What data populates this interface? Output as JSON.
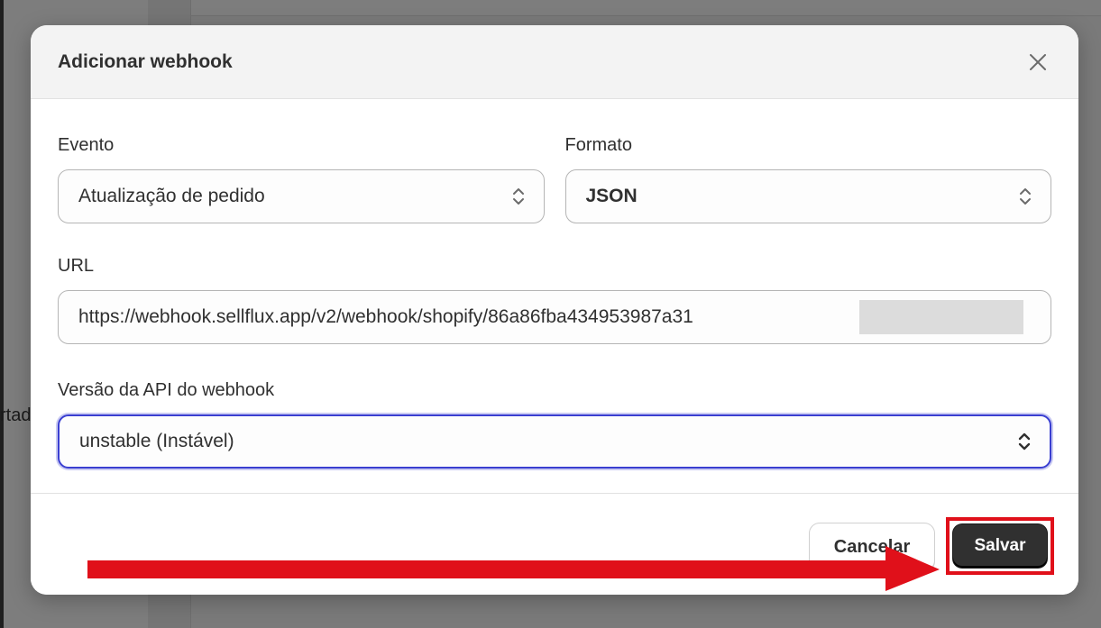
{
  "background": {
    "peek_text": "rtad"
  },
  "modal": {
    "title": "Adicionar webhook",
    "evento": {
      "label": "Evento",
      "value": "Atualização de pedido"
    },
    "formato": {
      "label": "Formato",
      "value": "JSON"
    },
    "url": {
      "label": "URL",
      "value": "https://webhook.sellflux.app/v2/webhook/shopify/86a86fba434953987a31"
    },
    "api_version": {
      "label": "Versão da API do webhook",
      "value": "unstable (Instável)"
    },
    "footer": {
      "cancel_label": "Cancelar",
      "save_label": "Salvar"
    }
  },
  "colors": {
    "annotation_red": "#e0101a",
    "focus_blue": "#3a3fd1",
    "primary_button": "#303030"
  },
  "icons": [
    "close-icon",
    "select-updown-icon"
  ]
}
